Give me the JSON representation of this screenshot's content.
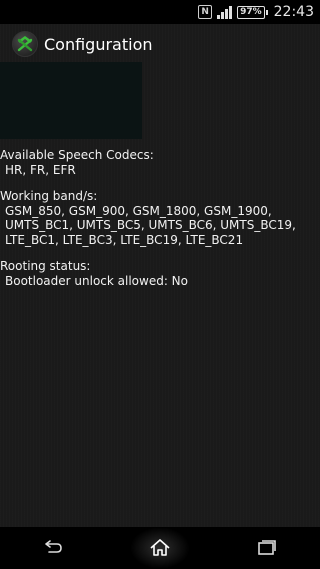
{
  "status_bar": {
    "battery": "97%",
    "time": "22:43",
    "icons": [
      "nfc-icon",
      "signal-icon",
      "battery-icon"
    ]
  },
  "action_bar": {
    "title": "Configuration",
    "icon": "app-logo-icon"
  },
  "sections": {
    "codecs_label": "Available Speech Codecs:",
    "codecs_value": "HR, FR, EFR",
    "bands_label": "Working band/s:",
    "bands_line1": "GSM_850, GSM_900, GSM_1800, GSM_1900,",
    "bands_line2": "UMTS_BC1, UMTS_BC5, UMTS_BC6, UMTS_BC19,",
    "bands_line3": "LTE_BC1, LTE_BC3, LTE_BC19, LTE_BC21",
    "rooting_label": "Rooting status:",
    "rooting_value": "Bootloader unlock allowed: No"
  },
  "nav_bar": {
    "icons": [
      "back-icon",
      "home-icon",
      "recent-apps-icon"
    ]
  }
}
